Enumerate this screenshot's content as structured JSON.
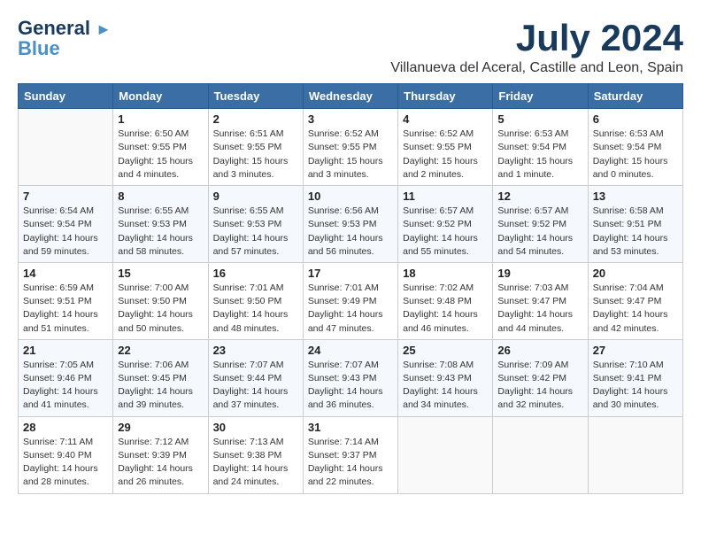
{
  "header": {
    "logo_line1": "General",
    "logo_line2": "Blue",
    "month": "July 2024",
    "location": "Villanueva del Aceral, Castille and Leon, Spain"
  },
  "weekdays": [
    "Sunday",
    "Monday",
    "Tuesday",
    "Wednesday",
    "Thursday",
    "Friday",
    "Saturday"
  ],
  "weeks": [
    [
      {
        "day": "",
        "info": ""
      },
      {
        "day": "1",
        "info": "Sunrise: 6:50 AM\nSunset: 9:55 PM\nDaylight: 15 hours\nand 4 minutes."
      },
      {
        "day": "2",
        "info": "Sunrise: 6:51 AM\nSunset: 9:55 PM\nDaylight: 15 hours\nand 3 minutes."
      },
      {
        "day": "3",
        "info": "Sunrise: 6:52 AM\nSunset: 9:55 PM\nDaylight: 15 hours\nand 3 minutes."
      },
      {
        "day": "4",
        "info": "Sunrise: 6:52 AM\nSunset: 9:55 PM\nDaylight: 15 hours\nand 2 minutes."
      },
      {
        "day": "5",
        "info": "Sunrise: 6:53 AM\nSunset: 9:54 PM\nDaylight: 15 hours\nand 1 minute."
      },
      {
        "day": "6",
        "info": "Sunrise: 6:53 AM\nSunset: 9:54 PM\nDaylight: 15 hours\nand 0 minutes."
      }
    ],
    [
      {
        "day": "7",
        "info": "Sunrise: 6:54 AM\nSunset: 9:54 PM\nDaylight: 14 hours\nand 59 minutes."
      },
      {
        "day": "8",
        "info": "Sunrise: 6:55 AM\nSunset: 9:53 PM\nDaylight: 14 hours\nand 58 minutes."
      },
      {
        "day": "9",
        "info": "Sunrise: 6:55 AM\nSunset: 9:53 PM\nDaylight: 14 hours\nand 57 minutes."
      },
      {
        "day": "10",
        "info": "Sunrise: 6:56 AM\nSunset: 9:53 PM\nDaylight: 14 hours\nand 56 minutes."
      },
      {
        "day": "11",
        "info": "Sunrise: 6:57 AM\nSunset: 9:52 PM\nDaylight: 14 hours\nand 55 minutes."
      },
      {
        "day": "12",
        "info": "Sunrise: 6:57 AM\nSunset: 9:52 PM\nDaylight: 14 hours\nand 54 minutes."
      },
      {
        "day": "13",
        "info": "Sunrise: 6:58 AM\nSunset: 9:51 PM\nDaylight: 14 hours\nand 53 minutes."
      }
    ],
    [
      {
        "day": "14",
        "info": "Sunrise: 6:59 AM\nSunset: 9:51 PM\nDaylight: 14 hours\nand 51 minutes."
      },
      {
        "day": "15",
        "info": "Sunrise: 7:00 AM\nSunset: 9:50 PM\nDaylight: 14 hours\nand 50 minutes."
      },
      {
        "day": "16",
        "info": "Sunrise: 7:01 AM\nSunset: 9:50 PM\nDaylight: 14 hours\nand 48 minutes."
      },
      {
        "day": "17",
        "info": "Sunrise: 7:01 AM\nSunset: 9:49 PM\nDaylight: 14 hours\nand 47 minutes."
      },
      {
        "day": "18",
        "info": "Sunrise: 7:02 AM\nSunset: 9:48 PM\nDaylight: 14 hours\nand 46 minutes."
      },
      {
        "day": "19",
        "info": "Sunrise: 7:03 AM\nSunset: 9:47 PM\nDaylight: 14 hours\nand 44 minutes."
      },
      {
        "day": "20",
        "info": "Sunrise: 7:04 AM\nSunset: 9:47 PM\nDaylight: 14 hours\nand 42 minutes."
      }
    ],
    [
      {
        "day": "21",
        "info": "Sunrise: 7:05 AM\nSunset: 9:46 PM\nDaylight: 14 hours\nand 41 minutes."
      },
      {
        "day": "22",
        "info": "Sunrise: 7:06 AM\nSunset: 9:45 PM\nDaylight: 14 hours\nand 39 minutes."
      },
      {
        "day": "23",
        "info": "Sunrise: 7:07 AM\nSunset: 9:44 PM\nDaylight: 14 hours\nand 37 minutes."
      },
      {
        "day": "24",
        "info": "Sunrise: 7:07 AM\nSunset: 9:43 PM\nDaylight: 14 hours\nand 36 minutes."
      },
      {
        "day": "25",
        "info": "Sunrise: 7:08 AM\nSunset: 9:43 PM\nDaylight: 14 hours\nand 34 minutes."
      },
      {
        "day": "26",
        "info": "Sunrise: 7:09 AM\nSunset: 9:42 PM\nDaylight: 14 hours\nand 32 minutes."
      },
      {
        "day": "27",
        "info": "Sunrise: 7:10 AM\nSunset: 9:41 PM\nDaylight: 14 hours\nand 30 minutes."
      }
    ],
    [
      {
        "day": "28",
        "info": "Sunrise: 7:11 AM\nSunset: 9:40 PM\nDaylight: 14 hours\nand 28 minutes."
      },
      {
        "day": "29",
        "info": "Sunrise: 7:12 AM\nSunset: 9:39 PM\nDaylight: 14 hours\nand 26 minutes."
      },
      {
        "day": "30",
        "info": "Sunrise: 7:13 AM\nSunset: 9:38 PM\nDaylight: 14 hours\nand 24 minutes."
      },
      {
        "day": "31",
        "info": "Sunrise: 7:14 AM\nSunset: 9:37 PM\nDaylight: 14 hours\nand 22 minutes."
      },
      {
        "day": "",
        "info": ""
      },
      {
        "day": "",
        "info": ""
      },
      {
        "day": "",
        "info": ""
      }
    ]
  ]
}
